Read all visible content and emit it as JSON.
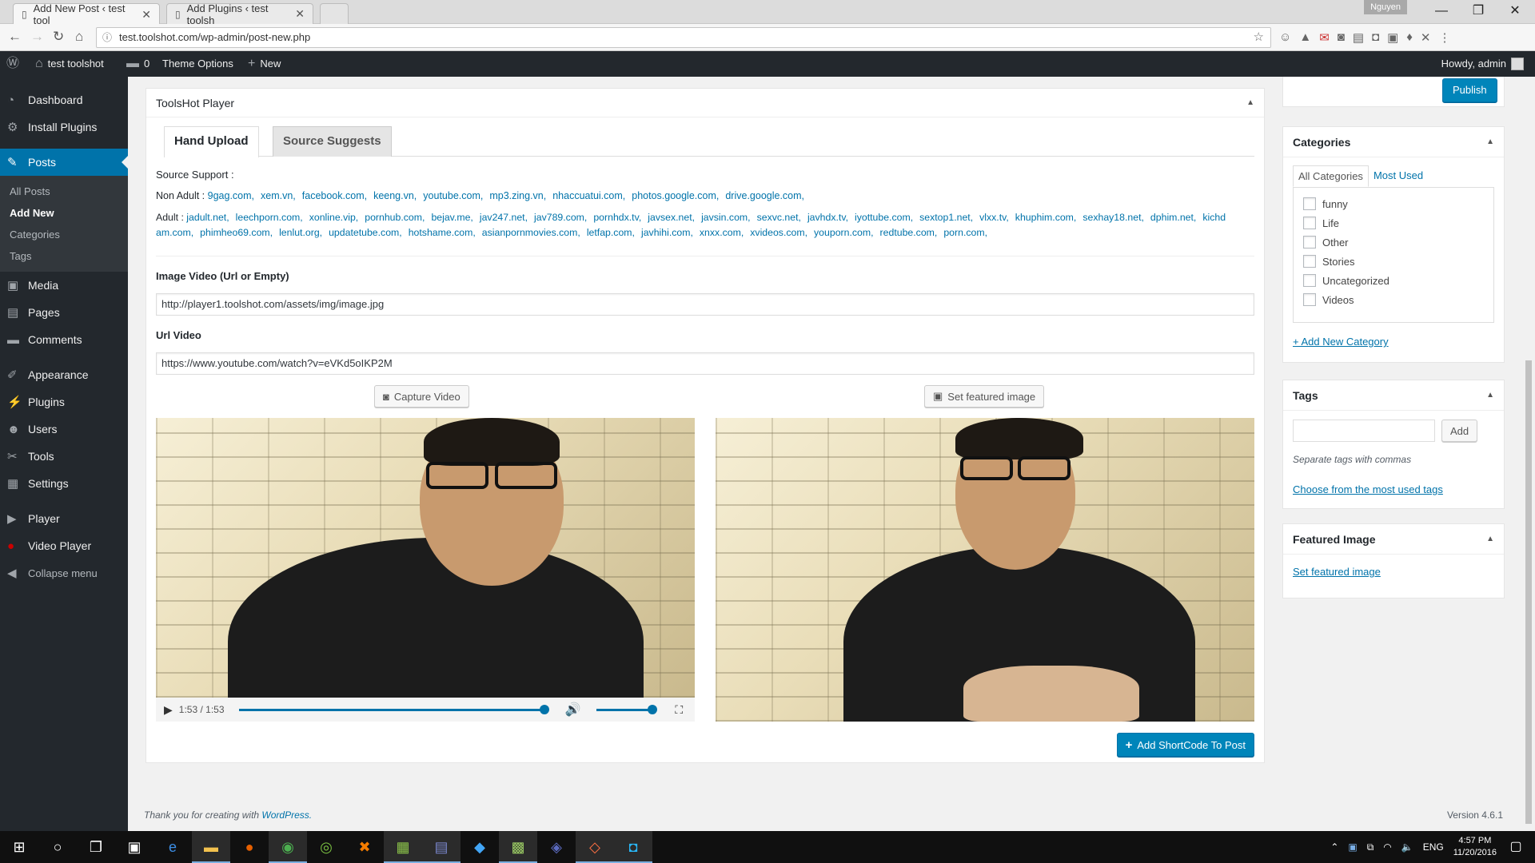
{
  "browser": {
    "tabs": [
      {
        "title": "Add New Post ‹ test tool"
      },
      {
        "title": "Add Plugins ‹ test toolsh"
      }
    ],
    "profile": "Nguyen",
    "url": "test.toolshot.com/wp-admin/post-new.php"
  },
  "adminbar": {
    "site": "test toolshot",
    "comments": "0",
    "theme_options": "Theme Options",
    "new": "New",
    "howdy": "Howdy, admin"
  },
  "sidebar": {
    "items": [
      {
        "label": "Dashboard",
        "icon": "dashboard-icon"
      },
      {
        "label": "Install Plugins",
        "icon": "gear-icon"
      },
      {
        "label": "Posts",
        "icon": "pin-icon"
      }
    ],
    "submenu": [
      "All Posts",
      "Add New",
      "Categories",
      "Tags"
    ],
    "items2": [
      {
        "label": "Media"
      },
      {
        "label": "Pages"
      },
      {
        "label": "Comments"
      }
    ],
    "items3": [
      {
        "label": "Appearance"
      },
      {
        "label": "Plugins"
      },
      {
        "label": "Users"
      },
      {
        "label": "Tools"
      },
      {
        "label": "Settings"
      }
    ],
    "items4": [
      {
        "label": "Player"
      },
      {
        "label": "Video Player"
      },
      {
        "label": "Collapse menu"
      }
    ]
  },
  "metabox": {
    "title": "ToolsHot Player",
    "tabs": [
      "Hand Upload",
      "Source Suggests"
    ],
    "source_support": "Source Support :",
    "non_adult_label": "Non Adult :",
    "non_adult": [
      "9gag.com,",
      "xem.vn,",
      "facebook.com,",
      "keeng.vn,",
      "youtube.com,",
      "mp3.zing.vn,",
      "nhaccuatui.com,",
      "photos.google.com,",
      "drive.google.com,"
    ],
    "adult_label": "Adult :",
    "adult_line1": [
      "jadult.net,",
      "leechporn.com,",
      "xonline.vip,",
      "pornhub.com,",
      "bejav.me,",
      "jav247.net,",
      "jav789.com,",
      "pornhdx.tv,",
      "javsex.net,",
      "javsin.com,",
      "sexvc.net,",
      "javhdx.tv,",
      "iyottube.com,",
      "sextop1.net,",
      "vlxx.tv,",
      "khuphim.com,",
      "sexhay18.net,",
      "dphim.net,",
      "kichd"
    ],
    "adult_line2": [
      "am.com,",
      "phimheo69.com,",
      "lenlut.org,",
      "updatetube.com,",
      "hotshame.com,",
      "asianpornmovies.com,",
      "letfap.com,",
      "javhihi.com,",
      "xnxx.com,",
      "xvideos.com,",
      "youporn.com,",
      "redtube.com,",
      "porn.com,"
    ],
    "image_label": "Image Video (Url or Empty)",
    "image_value": "http://player1.toolshot.com/assets/img/image.jpg",
    "url_label": "Url Video",
    "url_value": "https://www.youtube.com/watch?v=eVKd5oIKP2M",
    "capture": "Capture Video",
    "set_featured": "Set featured image",
    "time": "1:53 / 1:53",
    "progress": 1.0,
    "volume": 1.0,
    "add_shortcode": "Add ShortCode To Post"
  },
  "right": {
    "publish": "Publish",
    "categories": {
      "title": "Categories",
      "tab_all": "All Categories",
      "tab_most": "Most Used",
      "items": [
        "funny",
        "Life",
        "Other",
        "Stories",
        "Uncategorized",
        "Videos"
      ],
      "add_new": "+ Add New Category"
    },
    "tags": {
      "title": "Tags",
      "add": "Add",
      "hint": "Separate tags with commas",
      "choose": "Choose from the most used tags"
    },
    "featured": {
      "title": "Featured Image",
      "link": "Set featured image"
    }
  },
  "footer": {
    "thanks": "Thank you for creating with ",
    "wp": "WordPress.",
    "version": "Version 4.6.1"
  },
  "taskbar": {
    "lang": "ENG",
    "time": "4:57 PM",
    "date": "11/20/2016"
  }
}
